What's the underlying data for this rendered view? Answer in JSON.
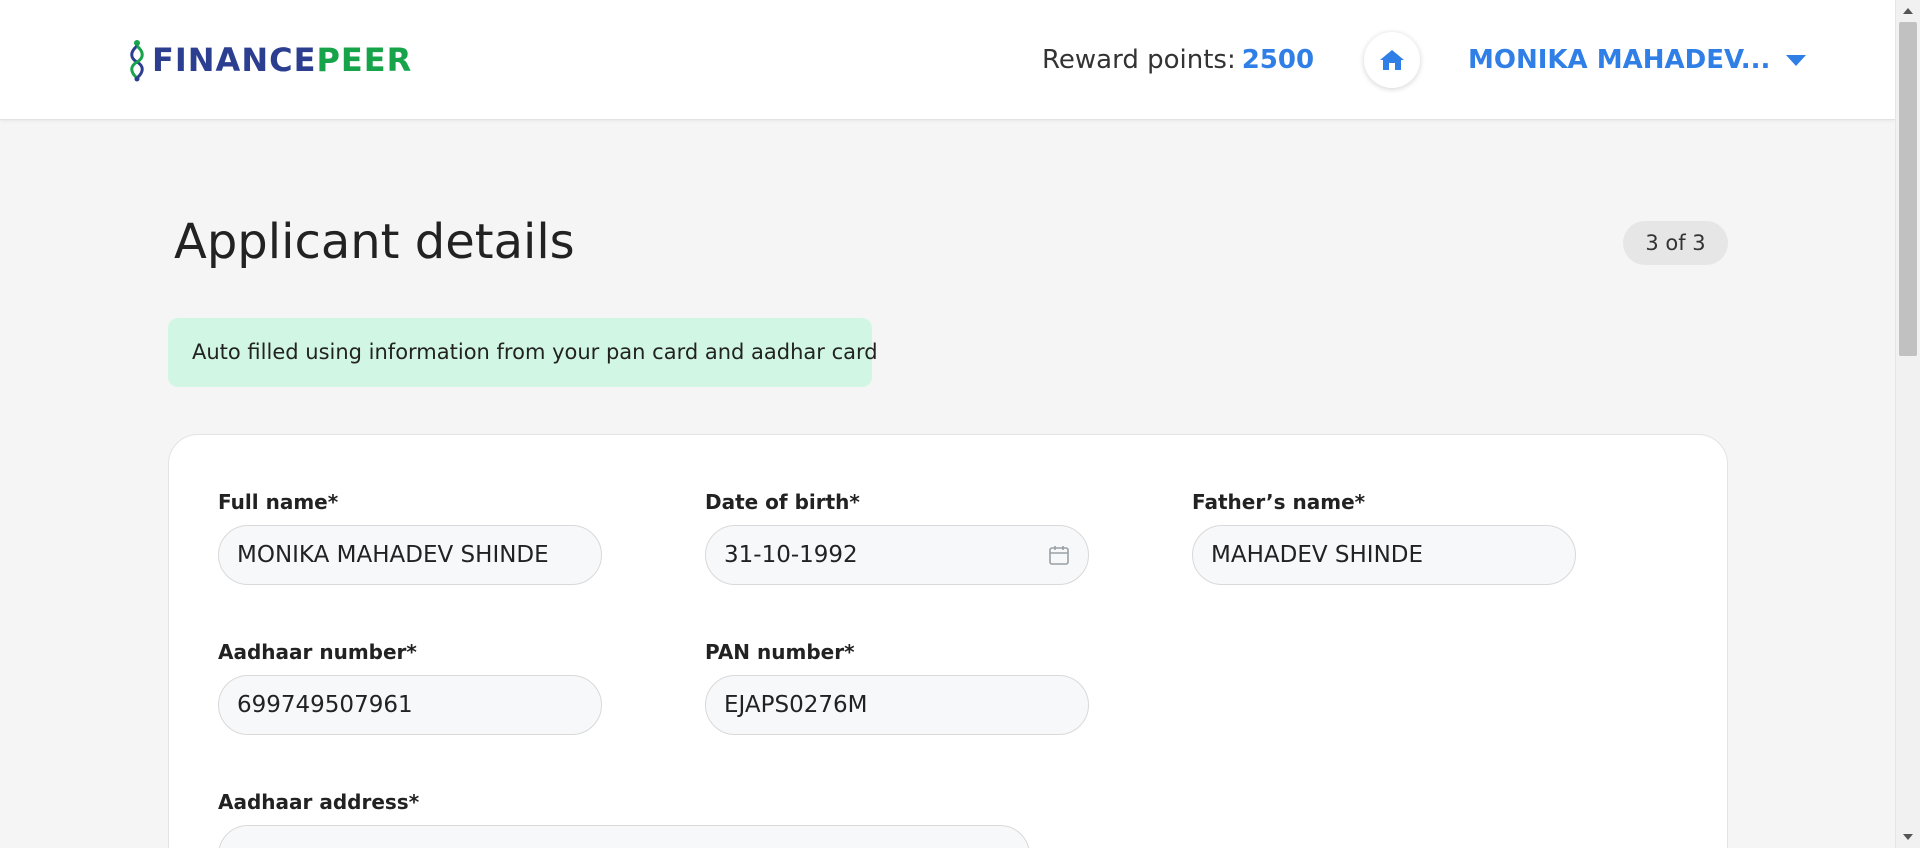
{
  "brand": {
    "name_part1": "FINANCE",
    "name_part2": "PEER",
    "colors": {
      "primary": "#2c3e8f",
      "accent_green": "#16a34a",
      "link_blue": "#2f7fe6"
    }
  },
  "header": {
    "reward_label": "Reward points:",
    "reward_value": "2500",
    "home_icon": "home-icon",
    "user_name": "MONIKA MAHADEV..."
  },
  "page": {
    "title": "Applicant details",
    "step": "3 of 3",
    "autofill_note": "Auto filled using information from your pan card and aadhar card"
  },
  "form": {
    "full_name": {
      "label": "Full name*",
      "value": "MONIKA MAHADEV SHINDE"
    },
    "dob": {
      "label": "Date of birth*",
      "value": "31-10-1992",
      "icon": "calendar-icon"
    },
    "father_name": {
      "label": "Father’s name*",
      "value": "MAHADEV SHINDE"
    },
    "aadhaar_number": {
      "label": "Aadhaar number*",
      "value": "699749507961"
    },
    "pan_number": {
      "label": "PAN number*",
      "value": "EJAPS0276M"
    },
    "aadhaar_address": {
      "label": "Aadhaar address*",
      "value": "..."
    }
  },
  "colors": {
    "page_bg": "#f5f5f5",
    "note_bg": "#d1f7e4",
    "pill_bg": "#e6e6e6"
  }
}
